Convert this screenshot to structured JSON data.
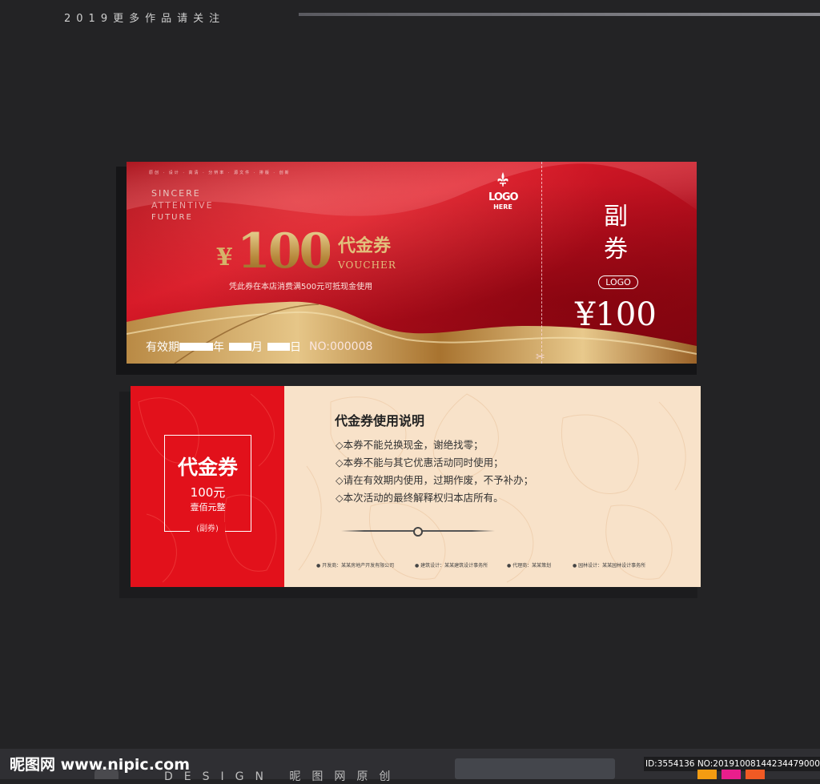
{
  "header": {
    "text": "2019更多作品请关注"
  },
  "front": {
    "small_tag": "原创 · 设计 · 高清 · 分辨率 · 源文件 · 排版 · 创新",
    "sincere": "SINCERE",
    "attentive": "ATTENTIVE",
    "future": "FUTURE",
    "yen": "¥",
    "amount": "100",
    "title": "代金券",
    "voucher": "VOUCHER",
    "description": "凭此券在本店消费满500元可抵现金使用",
    "validity_label": "有效期",
    "year": "年",
    "month": "月",
    "day": "日",
    "serial": "NO:000008",
    "logo": "LOGO",
    "logo_sub": "HERE",
    "scissors_icon": "✂"
  },
  "stub": {
    "label_1": "副",
    "label_2": "券",
    "logo": "LOGO",
    "amount": "¥100"
  },
  "back": {
    "title": "代金券",
    "amount": "100元",
    "amount_words": "壹佰元整",
    "copy_label": "(副券)",
    "heading": "代金券使用说明",
    "rules": [
      "◇本券不能兑换现金，谢绝找零；",
      "◇本券不能与其它优惠活动同时使用；",
      "◇请在有效期内使用，过期作废，不予补办；",
      "◇本次活动的最终解释权归本店所有。"
    ],
    "credits": [
      "● 开发商：某某房地产开发有限公司",
      "● 建筑设计：某某建筑设计事务所",
      "● 代理商：某某策划",
      "● 园林设计：某某园林设计事务所"
    ]
  },
  "watermark": {
    "logo": "昵图网 www.nipic.com",
    "design": "DESIGN 昵图网原创",
    "id": "ID:3554136 NO:20191008144234479000",
    "colors": [
      "#f39c12",
      "#e91e8c",
      "#f15a24"
    ]
  },
  "colors": {
    "accent_red": "#d71a28",
    "gold": "#cfa95e",
    "cream": "#f8e2c9"
  }
}
